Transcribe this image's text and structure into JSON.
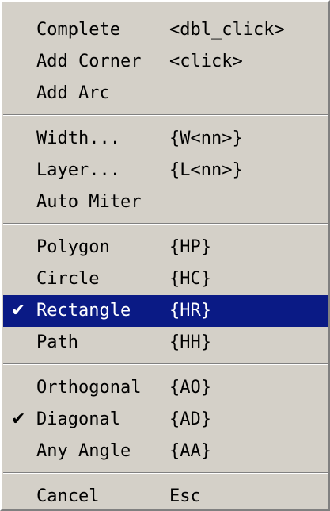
{
  "menu": {
    "groups": [
      {
        "items": [
          {
            "label": "Complete",
            "shortcut": "<dbl_click>",
            "checked": false,
            "selected": false
          },
          {
            "label": "Add Corner",
            "shortcut": "<click>",
            "checked": false,
            "selected": false
          },
          {
            "label": "Add Arc",
            "shortcut": "",
            "checked": false,
            "selected": false
          }
        ]
      },
      {
        "items": [
          {
            "label": "Width...",
            "shortcut": "{W<nn>}",
            "checked": false,
            "selected": false
          },
          {
            "label": "Layer...",
            "shortcut": "{L<nn>}",
            "checked": false,
            "selected": false
          },
          {
            "label": "Auto Miter",
            "shortcut": "",
            "checked": false,
            "selected": false
          }
        ]
      },
      {
        "items": [
          {
            "label": "Polygon",
            "shortcut": "{HP}",
            "checked": false,
            "selected": false
          },
          {
            "label": "Circle",
            "shortcut": "{HC}",
            "checked": false,
            "selected": false
          },
          {
            "label": "Rectangle",
            "shortcut": "{HR}",
            "checked": true,
            "selected": true
          },
          {
            "label": "Path",
            "shortcut": "{HH}",
            "checked": false,
            "selected": false
          }
        ]
      },
      {
        "items": [
          {
            "label": "Orthogonal",
            "shortcut": "{AO}",
            "checked": false,
            "selected": false
          },
          {
            "label": "Diagonal",
            "shortcut": "{AD}",
            "checked": true,
            "selected": false
          },
          {
            "label": "Any Angle",
            "shortcut": "{AA}",
            "checked": false,
            "selected": false
          }
        ]
      },
      {
        "items": [
          {
            "label": "Cancel",
            "shortcut": "Esc",
            "checked": false,
            "selected": false
          }
        ]
      }
    ],
    "check_glyph": "✔",
    "colors": {
      "background": "#d4d0c8",
      "highlight": "#0a1a85",
      "highlight_text": "#ffffff",
      "text": "#000000"
    }
  }
}
